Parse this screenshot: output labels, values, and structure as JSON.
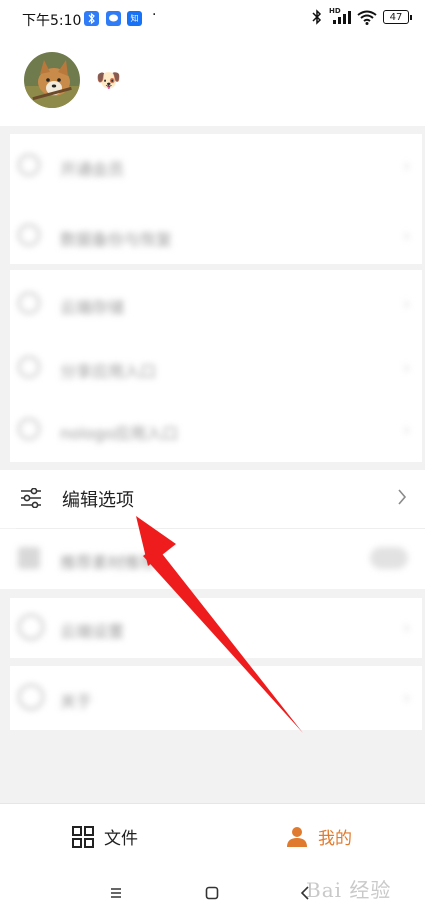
{
  "status_bar": {
    "time": "下午5:10",
    "apps": [
      "bluetooth-app-icon",
      "message-app-icon",
      "zhihu-app-icon"
    ],
    "zhihu_label": "知乎",
    "dot": "·",
    "network": "HD",
    "battery": "47"
  },
  "profile": {
    "avatar": "dog-avatar",
    "nickname": "🐶"
  },
  "menu_group_1": [
    {
      "label": "开通会员",
      "icon": "vip-icon"
    },
    {
      "label": "数据备份与恢复",
      "icon": "backup-icon"
    }
  ],
  "menu_group_2": [
    {
      "label": "云端存储",
      "icon": "cloud-icon"
    },
    {
      "label": "分享应用入口",
      "icon": "share-icon"
    },
    {
      "label": "nologo应用入口",
      "icon": "entry-icon"
    }
  ],
  "edit_options": {
    "label": "编辑选项",
    "icon": "sliders-icon"
  },
  "toggle_row": {
    "label": "推荐素材推荐",
    "icon": "doc-icon"
  },
  "settings_row": {
    "label": "云端设置",
    "icon": "settings-icon"
  },
  "about_row": {
    "label": "关于",
    "icon": "about-icon"
  },
  "bottom_nav": {
    "files_label": "文件",
    "mine_label": "我的",
    "active_color": "#e07a2e"
  },
  "system_nav": [
    "menu-icon",
    "home-icon",
    "back-icon"
  ],
  "watermark": "Bai 经验"
}
